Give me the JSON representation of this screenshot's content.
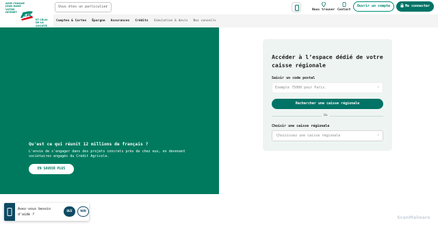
{
  "header": {
    "logo": {
      "slogan": "AGIR CHAQUE JOUR DANS VOTRE INTÉRÊT",
      "monogram": "CA",
      "tagline": "ET CELUI DE LA SOCIÉTÉ"
    },
    "profile_select": {
      "value": "Vous êtes un particulier"
    },
    "nav": [
      {
        "label": "Comptes & Cartes"
      },
      {
        "label": "Épargne"
      },
      {
        "label": "Assurances"
      },
      {
        "label": "Crédits"
      },
      {
        "label": "Simulation & devis"
      },
      {
        "label": "Nos conseils"
      }
    ],
    "find_us": "Nous trouver",
    "contact": "Contact",
    "open_account": "Ouvrir un compte",
    "login": "Me connecter"
  },
  "hero": {
    "title": "Qu'est ce qui réunit 12 millions de français ?",
    "description": "L'envie de s'engager dans des projets concrets près de chez eux, en devenant sociétaires engagés du Crédit Agricole.",
    "cta": "EN SAVOIR PLUS"
  },
  "panel": {
    "title": "Accéder à l’espace dédié de votre caisse régionale",
    "postal_label": "Saisir un code postal",
    "postal_placeholder": "Exemple 75000 pour Paris.",
    "search_button": "Rechercher une caisse régionale",
    "or_text": "Ou",
    "choose_label": "Choisir une caisse régionale",
    "choose_placeholder": "Choisissez une caisse régionale"
  },
  "help": {
    "question": "Avez-vous besoin d'aide ?",
    "yes": "OUI",
    "no": "NON"
  },
  "watermark": "ScanMalware",
  "colors": {
    "brand_green": "#007a5e",
    "button_green": "#007366",
    "panel_bg": "#eef4f2",
    "help_blue": "#0e4a63"
  }
}
